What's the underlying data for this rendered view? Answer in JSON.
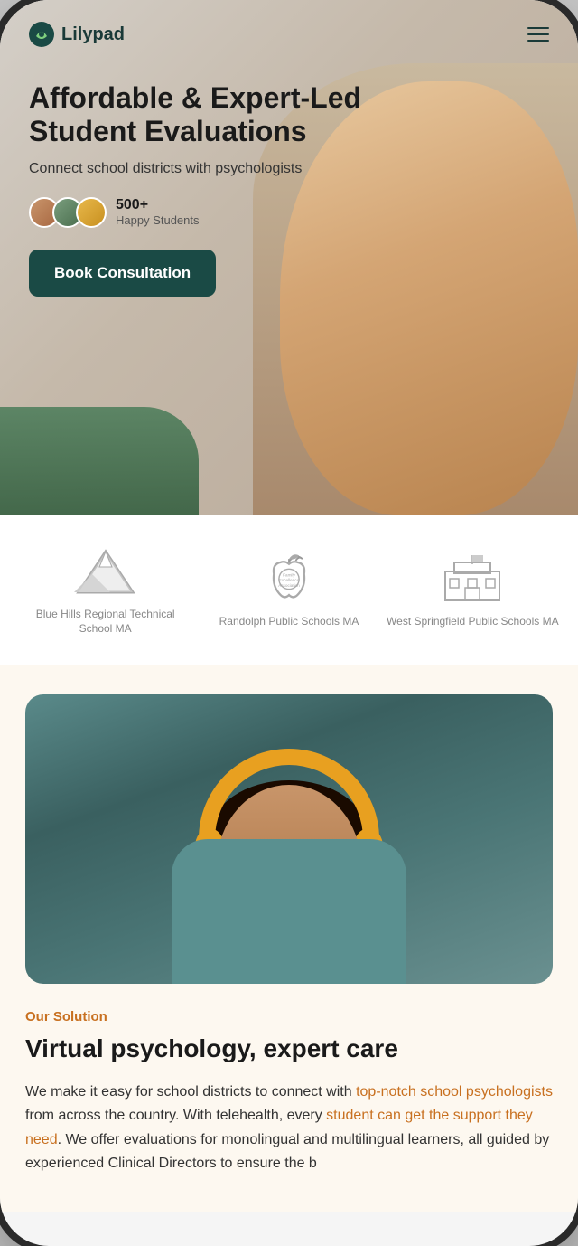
{
  "nav": {
    "logo_text": "Lilypad",
    "menu_aria": "Open menu"
  },
  "hero": {
    "title_line1": "Affordable & Expert-Led",
    "title_line2": "Student Evaluations",
    "subtitle": "Connect school districts with psychologists",
    "happy_count": "500+",
    "happy_label": "Happy Students",
    "cta_label": "Book Consultation"
  },
  "logos": {
    "items": [
      {
        "name": "Blue Hills Regional Technical School MA"
      },
      {
        "name": "Randolph Public Schools MA"
      },
      {
        "name": "West Springfield Public Schools MA"
      }
    ]
  },
  "solution": {
    "section_label": "Our Solution",
    "title": "Virtual psychology, expert care",
    "body_part1": "We make it easy for school districts to connect with ",
    "link1": "top-notch school psychologists",
    "body_part2": " from across the country. With telehealth, every ",
    "link2": "student can get the support they need",
    "body_part3": ". We offer evaluations for monolingual and multilingual learners, all guided by experienced Clinical Directors to ensure the b"
  }
}
